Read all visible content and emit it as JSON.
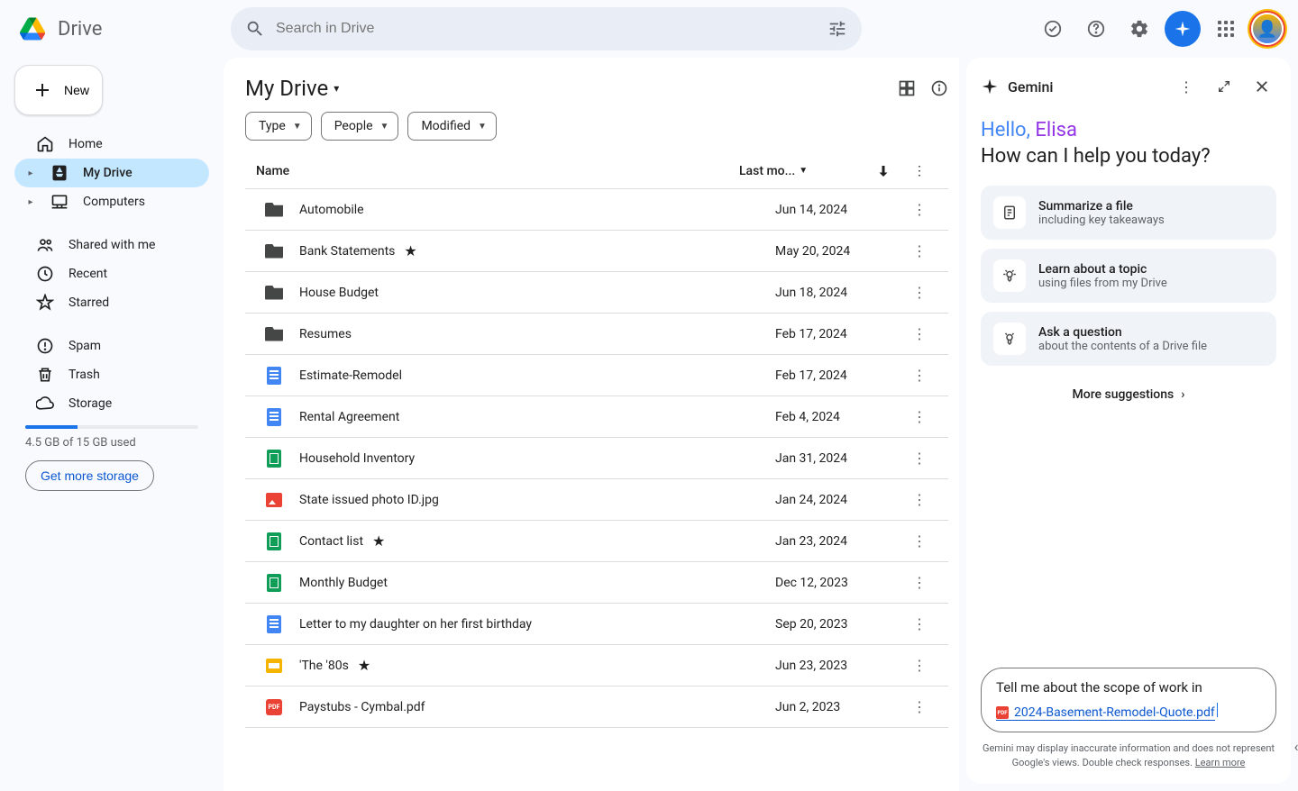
{
  "app": {
    "name": "Drive"
  },
  "search": {
    "placeholder": "Search in Drive"
  },
  "sidebar": {
    "new_label": "New",
    "items": [
      {
        "label": "Home",
        "icon": "home",
        "caret": false
      },
      {
        "label": "My Drive",
        "icon": "drive",
        "active": true,
        "caret": true
      },
      {
        "label": "Computers",
        "icon": "computer",
        "caret": true
      }
    ],
    "items2": [
      {
        "label": "Shared with me",
        "icon": "shared"
      },
      {
        "label": "Recent",
        "icon": "recent"
      },
      {
        "label": "Starred",
        "icon": "star"
      }
    ],
    "items3": [
      {
        "label": "Spam",
        "icon": "spam"
      },
      {
        "label": "Trash",
        "icon": "trash"
      },
      {
        "label": "Storage",
        "icon": "storage"
      }
    ],
    "storage_text": "4.5 GB of 15 GB used",
    "storage_btn": "Get more storage",
    "storage_pct": 30
  },
  "main": {
    "title": "My Drive",
    "chips": {
      "type": "Type",
      "people": "People",
      "modified": "Modified"
    },
    "columns": {
      "name": "Name",
      "date": "Last mo..."
    },
    "files": [
      {
        "name": "Automobile",
        "date": "Jun 14, 2024",
        "type": "folder",
        "star": false
      },
      {
        "name": "Bank Statements",
        "date": "May 20, 2024",
        "type": "folder",
        "star": true
      },
      {
        "name": "House Budget",
        "date": "Jun 18, 2024",
        "type": "folder",
        "star": false
      },
      {
        "name": "Resumes",
        "date": "Feb 17, 2024",
        "type": "folder",
        "star": false
      },
      {
        "name": "Estimate-Remodel",
        "date": "Feb 17, 2024",
        "type": "doc",
        "star": false
      },
      {
        "name": "Rental Agreement",
        "date": "Feb 4, 2024",
        "type": "doc",
        "star": false
      },
      {
        "name": "Household Inventory",
        "date": "Jan 31, 2024",
        "type": "sheet",
        "star": false
      },
      {
        "name": "State issued photo ID.jpg",
        "date": "Jan 24, 2024",
        "type": "image",
        "star": false
      },
      {
        "name": "Contact list",
        "date": "Jan 23, 2024",
        "type": "sheet",
        "star": true
      },
      {
        "name": "Monthly Budget",
        "date": "Dec 12, 2023",
        "type": "sheet",
        "star": false
      },
      {
        "name": "Letter to my daughter on her first birthday",
        "date": "Sep 20, 2023",
        "type": "doc",
        "star": false
      },
      {
        "name": "'The '80s",
        "date": "Jun 23, 2023",
        "type": "slide",
        "star": true
      },
      {
        "name": "Paystubs - Cymbal.pdf",
        "date": "Jun 2, 2023",
        "type": "pdf",
        "star": false
      }
    ]
  },
  "gemini": {
    "title": "Gemini",
    "hello": "Hello, ",
    "name": "Elisa",
    "subgreet": "How can I help you today?",
    "suggestions": [
      {
        "title": "Summarize a file",
        "sub": "including key takeaways",
        "icon": "summary"
      },
      {
        "title": "Learn about a topic",
        "sub": "using files from my Drive",
        "icon": "learn"
      },
      {
        "title": "Ask a question",
        "sub": "about the contents of a Drive file",
        "icon": "ask"
      }
    ],
    "more": "More suggestions",
    "prompt_text": "Tell me about the scope of work in",
    "prompt_file": "2024-Basement-Remodel-Quote.pdf",
    "disclaimer": "Gemini may display inaccurate information and does not represent Google's views. Double check responses. ",
    "learn_more": "Learn more"
  }
}
